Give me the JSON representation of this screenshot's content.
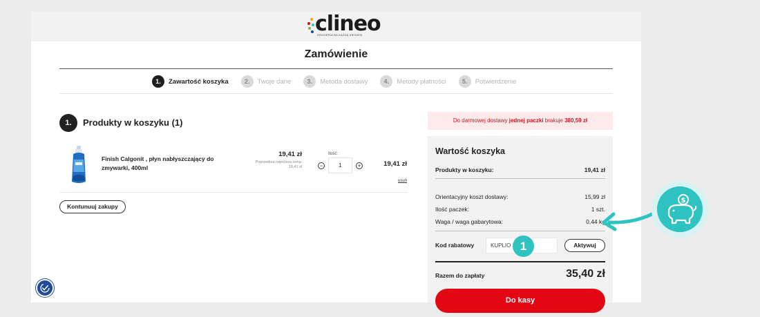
{
  "colors": {
    "accent_teal": "#2ec3c0",
    "brand_red": "#e30613",
    "notice_bg": "#fdeaea"
  },
  "header": {
    "logo_text": "clineo",
    "logo_tagline": "DROGERIA NA KAŻDĄ KIESZEŃ",
    "page_title": "Zamówienie"
  },
  "steps": [
    {
      "num": "1.",
      "label": "Zawartość koszyka",
      "active": true
    },
    {
      "num": "2.",
      "label": "Twoje dane",
      "active": false
    },
    {
      "num": "3.",
      "label": "Metoda dostawy",
      "active": false
    },
    {
      "num": "4.",
      "label": "Metody płatności",
      "active": false
    },
    {
      "num": "5.",
      "label": "Potwierdzenie",
      "active": false
    }
  ],
  "cart": {
    "section_num": "1.",
    "section_title": "Produkty w koszyku (1)",
    "items": [
      {
        "name": "Finish Calgonit , płyn nabłyszczający do zmywarki, 400ml",
        "price": "19,41 zł",
        "prev_price_label": "Poprzednia najniższa cena:",
        "prev_price": "19,41 zł",
        "qty_label": "Ilość:",
        "qty": "1",
        "line_total": "19,41 zł",
        "remove_label": "usuń"
      }
    ],
    "continue_label": "Kontunuuj zakupy"
  },
  "delivery_notice": {
    "prefix": "Do darmowej dostawy ",
    "highlight": "jednej paczki",
    "middle": " brakuje ",
    "amount": "380,59 zł"
  },
  "summary": {
    "title": "Wartość koszyka",
    "products_label": "Produkty w koszyku:",
    "products_value": "19,41 zł",
    "shipping_label": "Orientacyjny koszt dostawy:",
    "shipping_value": "15,99 zł",
    "packages_label": "Ilość paczek:",
    "packages_value": "1 szt.",
    "weight_label": "Waga / waga gabarytowa:",
    "weight_value": "0,44 kg",
    "coupon_label": "Kod rabatowy",
    "coupon_value": "KUPLIO",
    "coupon_badge": "1",
    "activate_label": "Aktywuj",
    "total_label": "Razem do zapłaty",
    "total_value": "35,40 zł",
    "checkout_label": "Do kasy"
  },
  "icons": {
    "accessibility": "accessibility-icon",
    "piggy_bank": "piggy-bank-icon",
    "arrow": "arrow-pointer-icon"
  }
}
